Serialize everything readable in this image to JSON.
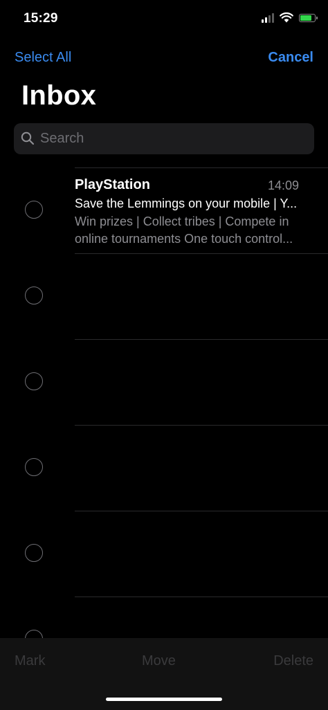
{
  "status_bar": {
    "time": "15:29",
    "battery_color": "#32d74b",
    "icons": [
      "signal-icon",
      "wifi-icon",
      "battery-charging-icon"
    ]
  },
  "nav": {
    "select_all_label": "Select All",
    "cancel_label": "Cancel",
    "accent_color": "#3a8bf0"
  },
  "page_title": "Inbox",
  "search": {
    "placeholder": "Search",
    "value": ""
  },
  "messages": [
    {
      "sender": "PlayStation",
      "time": "14:09",
      "subject": "Save the Lemmings on your mobile | Y...",
      "preview": "Win prizes | Collect tribes | Compete in online tournaments One touch control..."
    }
  ],
  "toolbar": {
    "mark_label": "Mark",
    "move_label": "Move",
    "delete_label": "Delete"
  }
}
